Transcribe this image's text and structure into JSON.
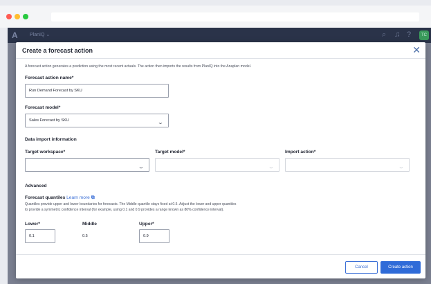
{
  "app": {
    "logo": "A",
    "name": "PlanIQ  ⌄",
    "avatar_initials": "TC",
    "header_icons": {
      "search": "⌕",
      "bell": "♫",
      "help": "?"
    }
  },
  "modal": {
    "title": "Create a forecast action",
    "close": "✕",
    "intro": "A forecast action generates a prediction using the most recent actuals. The action then imports the results from PlanIQ into the Anaplan model.",
    "action_name": {
      "label": "Forecast action name*",
      "value": "Run Demand Forecast by SKU"
    },
    "model": {
      "label": "Forecast model*",
      "value": "Sales Forecast by SKU"
    },
    "import_section": "Data import information",
    "target_workspace": {
      "label": "Target workspace*",
      "value": ""
    },
    "target_model": {
      "label": "Target model*",
      "value": ""
    },
    "import_action": {
      "label": "Import action*",
      "value": ""
    },
    "advanced": "Advanced",
    "quantiles": {
      "label": "Forecast quantiles",
      "learn_more": "Learn more",
      "help_line1": "Quantiles provide upper and lower boundaries for forecasts. The Middle quantile stays fixed at 0.5. Adjust the lower and upper quantiles",
      "help_line2": "to provide a symmetric confidence interval (for example, using 0.1 and 0.9 provides a range known as 80% confidence interval).",
      "lower_label": "Lower*",
      "lower_value": "0.1",
      "middle_label": "Middle",
      "middle_value": "0.5",
      "upper_label": "Upper*",
      "upper_value": "0.9"
    },
    "buttons": {
      "cancel": "Cancel",
      "create": "Create action"
    }
  },
  "colors": {
    "primary": "#2f6bd8",
    "header": "#2a3349",
    "avatar": "#3a9a5b"
  }
}
